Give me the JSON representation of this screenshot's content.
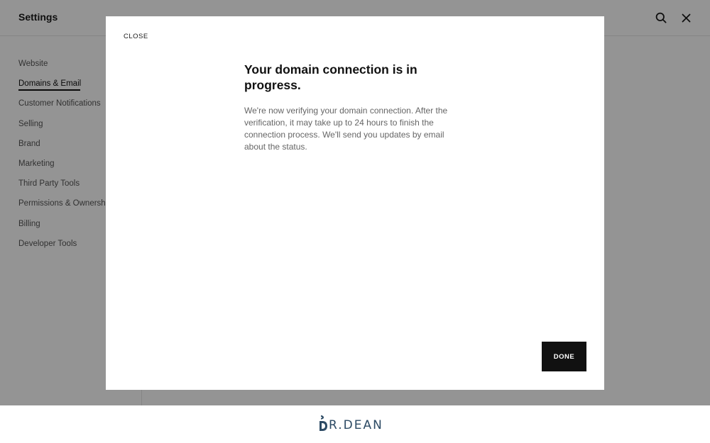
{
  "app": {
    "title": "Settings"
  },
  "sidebar": {
    "items": [
      {
        "label": "Website",
        "active": false
      },
      {
        "label": "Domains & Email",
        "active": true
      },
      {
        "label": "Customer Notifications",
        "active": false
      },
      {
        "label": "Selling",
        "active": false
      },
      {
        "label": "Brand",
        "active": false
      },
      {
        "label": "Marketing",
        "active": false
      },
      {
        "label": "Third Party Tools",
        "active": false
      },
      {
        "label": "Permissions & Ownersh",
        "active": false
      },
      {
        "label": "Billing",
        "active": false
      },
      {
        "label": "Developer Tools",
        "active": false
      }
    ]
  },
  "header": {
    "search_icon": "search-icon",
    "close_icon": "close-icon"
  },
  "modal": {
    "close_label": "CLOSE",
    "heading": "Your domain connection is in progress.",
    "body": "We're now verifying your domain connection. After the verification, it may take up to 24 hours to finish the connection process. We'll send you updates by email about the status.",
    "done_label": "DONE"
  },
  "brand": {
    "text": "R.DEAN",
    "color": "#2c4a64"
  }
}
